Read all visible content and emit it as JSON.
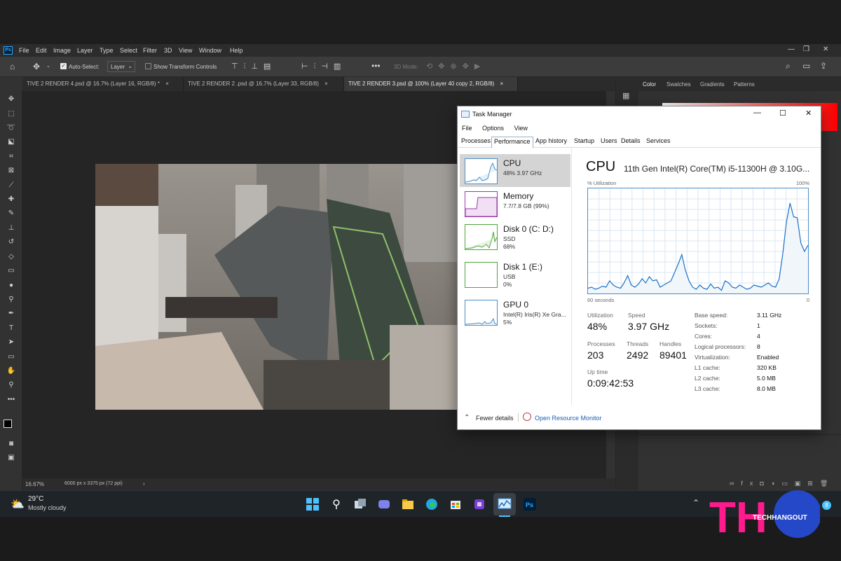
{
  "photoshop": {
    "logo": "Ps",
    "menu": [
      "File",
      "Edit",
      "Image",
      "Layer",
      "Type",
      "Select",
      "Filter",
      "3D",
      "View",
      "Window",
      "Help"
    ],
    "options": {
      "auto_select_label": "Auto-Select:",
      "layer_dropdown": "Layer",
      "show_transform_label": "Show Transform Controls",
      "mode_3d_label": "3D Mode:"
    },
    "tabs": [
      "TIVE 2 RENDER 4.psd @ 16.7% (Layer 16, RGB/8) *",
      "TIVE 2 RENDER 2 .psd @ 16.7% (Layer 33, RGB/8)",
      "TIVE 2 RENDER 3.psd @ 100% (Layer 40 copy 2, RGB/8)"
    ],
    "status": {
      "zoom": "16.67%",
      "doc_size": "6000 px x 3375 px (72 ppi)"
    },
    "panel_tabs": [
      "Color",
      "Swatches",
      "Gradients",
      "Patterns"
    ]
  },
  "task_manager": {
    "title": "Task Manager",
    "menu": [
      "File",
      "Options",
      "View"
    ],
    "tabs": [
      "Processes",
      "Performance",
      "App history",
      "Startup",
      "Users",
      "Details",
      "Services"
    ],
    "resources": [
      {
        "name": "CPU",
        "line2": "48%  3.97 GHz",
        "line3": ""
      },
      {
        "name": "Memory",
        "line2": "7.7/7.8 GB (99%)",
        "line3": ""
      },
      {
        "name": "Disk 0 (C: D:)",
        "line2": "SSD",
        "line3": "68%"
      },
      {
        "name": "Disk 1 (E:)",
        "line2": "USB",
        "line3": "0%"
      },
      {
        "name": "GPU 0",
        "line2": "Intel(R) Iris(R) Xe Gra...",
        "line3": "5%"
      }
    ],
    "cpu": {
      "title": "CPU",
      "model": "11th Gen Intel(R) Core(TM) i5-11300H @ 3.10G...",
      "graph_label_left": "% Utilization",
      "graph_label_right": "100%",
      "graph_label_bottom_left": "60 seconds",
      "graph_label_bottom_right": "0",
      "graph_points": [
        5,
        6,
        4,
        5,
        7,
        6,
        12,
        8,
        6,
        5,
        10,
        17,
        8,
        6,
        9,
        14,
        10,
        16,
        12,
        13,
        6,
        8,
        10,
        12,
        20,
        28,
        37,
        22,
        12,
        6,
        4,
        8,
        5,
        4,
        9,
        5,
        6,
        3,
        12,
        10,
        6,
        5,
        8,
        6,
        4,
        5,
        8,
        7,
        6,
        8,
        10,
        7,
        6,
        14,
        38,
        68,
        86,
        73,
        72,
        48,
        40,
        46
      ],
      "utilization_label": "Utilization",
      "utilization": "48%",
      "speed_label": "Speed",
      "speed": "3.97 GHz",
      "processes_label": "Processes",
      "processes": "203",
      "threads_label": "Threads",
      "threads": "2492",
      "handles_label": "Handles",
      "handles": "89401",
      "uptime_label": "Up time",
      "uptime": "0:09:42:53",
      "specs": [
        {
          "label": "Base speed:",
          "value": "3.11 GHz"
        },
        {
          "label": "Sockets:",
          "value": "1"
        },
        {
          "label": "Cores:",
          "value": "4"
        },
        {
          "label": "Logical processors:",
          "value": "8"
        },
        {
          "label": "Virtualization:",
          "value": "Enabled"
        },
        {
          "label": "L1 cache:",
          "value": "320 KB"
        },
        {
          "label": "L2 cache:",
          "value": "5.0 MB"
        },
        {
          "label": "L3 cache:",
          "value": "8.0 MB"
        }
      ]
    },
    "footer": {
      "fewer_details": "Fewer details",
      "resource_monitor": "Open Resource Monitor"
    }
  },
  "taskbar": {
    "temperature": "29°C",
    "weather": "Mostly cloudy",
    "notification_count": "8"
  },
  "watermark": {
    "letters": "TH",
    "brand": "TECHHANGOUT"
  }
}
